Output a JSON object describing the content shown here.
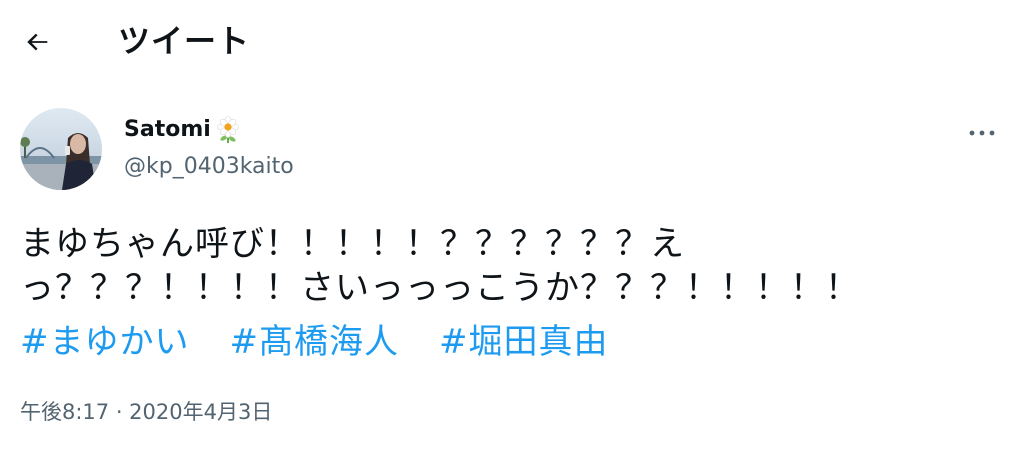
{
  "header": {
    "title": "ツイート",
    "back_icon": "arrow-left-icon"
  },
  "tweet": {
    "author": {
      "display_name": "Satomi",
      "name_emoji_icon": "flower-icon",
      "username": "@kp_0403kaito"
    },
    "more_icon": "more-horizontal-icon",
    "text_lines": [
      "まゆちゃん呼び！！！！！？？？？？？え",
      "っ？？？！！！！さいっっっこうか？？？！！！！！"
    ],
    "hashtags": [
      "#まゆかい",
      "#髙橋海人",
      "#堀田真由"
    ],
    "timestamp": "午後8:17 · 2020年4月3日"
  },
  "colors": {
    "text": "#0f1419",
    "secondary_text": "#536471",
    "link": "#1d9bf0"
  }
}
